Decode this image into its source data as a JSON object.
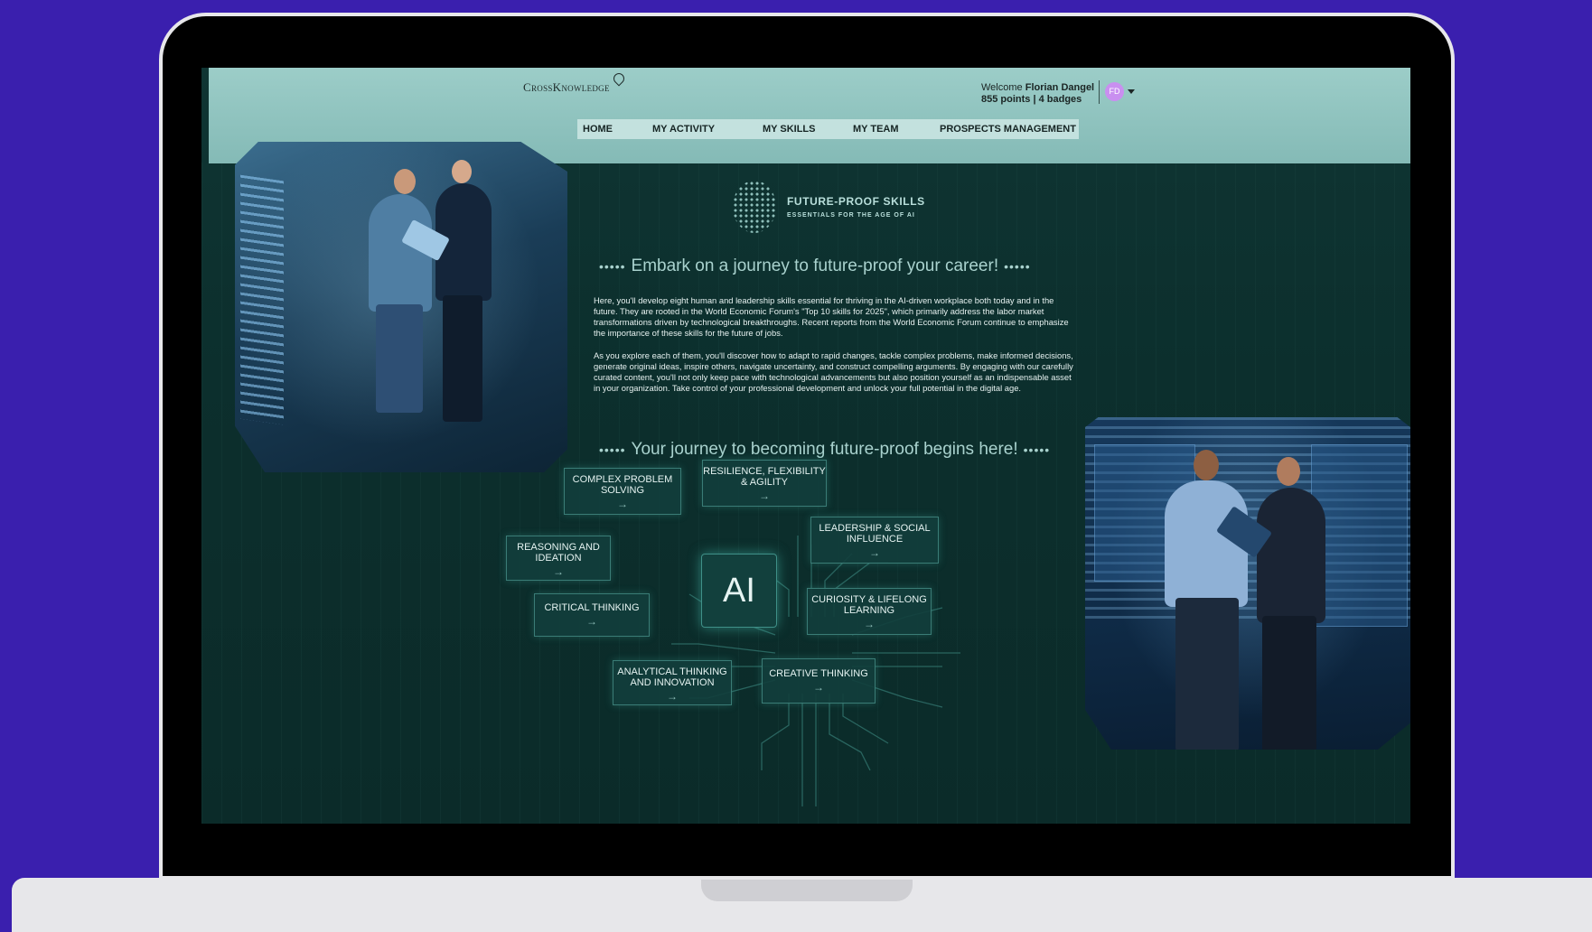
{
  "app": {
    "logo": "CrossKnowledge",
    "welcome_prefix": "Welcome",
    "user_name": "Florian Dangel",
    "stats": "855 points | 4 badges",
    "avatar_initials": "FD"
  },
  "nav": {
    "items": [
      {
        "label": "HOME"
      },
      {
        "label": "MY ACTIVITY"
      },
      {
        "label": "MY SKILLS"
      },
      {
        "label": "MY TEAM"
      },
      {
        "label": "PROSPECTS MANAGEMENT"
      }
    ]
  },
  "banner": {
    "title": "FUTURE-PROOF SKILLS",
    "subtitle": "ESSENTIALS FOR THE AGE OF AI"
  },
  "content": {
    "heading1": "Embark on a journey to future-proof your career!",
    "paragraph1": "Here, you'll develop eight human and leadership skills essential for thriving in the AI-driven workplace both today and in the future. They are rooted in the World Economic Forum's \"Top 10 skills for 2025\", which primarily address the labor market transformations driven by technological breakthroughs. Recent reports from the World Economic Forum continue to emphasize the importance of these skills for the future of jobs.",
    "paragraph2": "As you explore each of them, you'll discover how to adapt to rapid changes, tackle complex problems, make informed decisions, generate original ideas, inspire others, navigate uncertainty, and construct compelling arguments. By engaging with our carefully curated content, you'll not only keep pace with technological advancements but also position yourself as an indispensable asset in your organization. Take control of your professional development and unlock your full potential in the digital age.",
    "heading2": "Your journey to becoming future-proof begins here!",
    "dots": "•••••",
    "down_dots": "⠿"
  },
  "skills": {
    "center": "AI",
    "arrow": "→",
    "complex": "COMPLEX PROBLEM SOLVING",
    "resilience": "RESILIENCE, FLEXIBILITY & AGILITY",
    "leadership": "LEADERSHIP & SOCIAL INFLUENCE",
    "reasoning": "REASONING AND IDEATION",
    "curiosity": "CURIOSITY & LIFELONG LEARNING",
    "critical": "CRITICAL THINKING",
    "analytical": "ANALYTICAL THINKING AND INNOVATION",
    "creative": "CREATIVE THINKING"
  }
}
